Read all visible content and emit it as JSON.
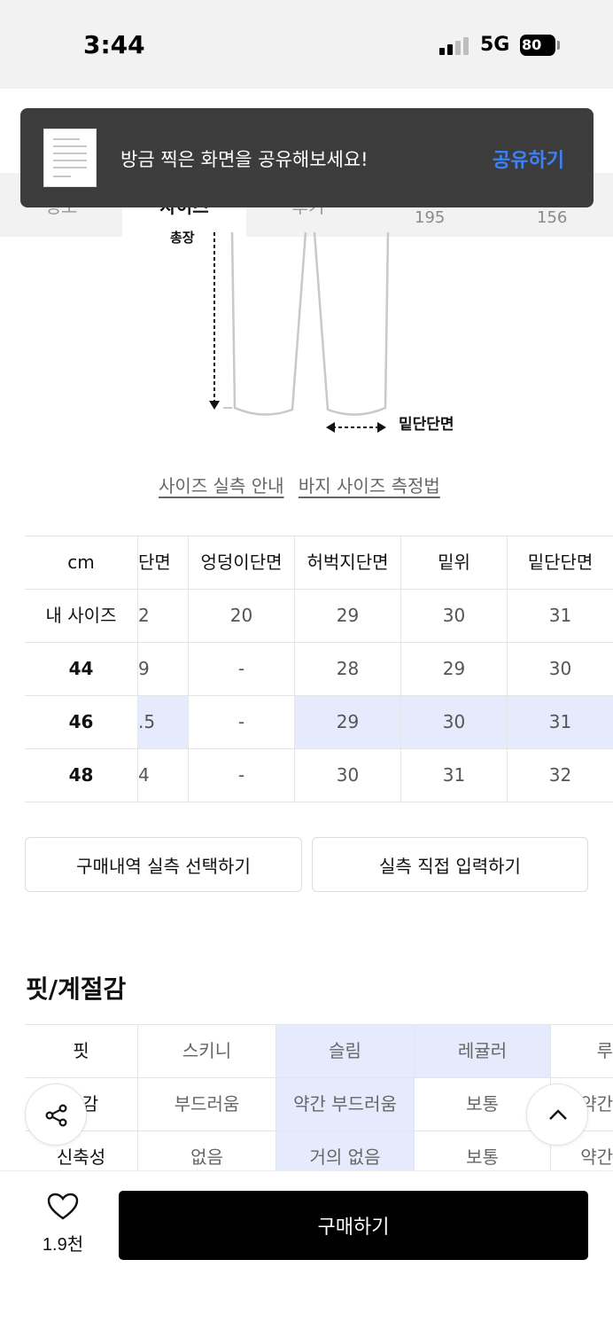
{
  "status_bar": {
    "time": "3:44",
    "network": "5G",
    "battery": "80"
  },
  "tabs": {
    "items": [
      {
        "label": "정보"
      },
      {
        "label": "사이즈"
      },
      {
        "label": "후기"
      }
    ],
    "active_index": 1,
    "overflow_values": [
      "195",
      "156"
    ]
  },
  "toast": {
    "message": "방금 찍은 화면을 공유해보세요!",
    "action": "공유하기"
  },
  "diagram": {
    "label_length": "총장",
    "label_bottom": "밑단단면"
  },
  "links": {
    "size_guide": "사이즈 실측 안내",
    "measure_guide": "바지 사이즈 측정법"
  },
  "size_table": {
    "corner": "cm",
    "columns": [
      "단면",
      "엉덩이단면",
      "허벅지단면",
      "밑위",
      "밑단단면"
    ],
    "rows": [
      {
        "name": "내 사이즈",
        "values": [
          "2",
          "20",
          "29",
          "30",
          "31"
        ]
      },
      {
        "name": "44",
        "values": [
          "9",
          "-",
          "28",
          "29",
          "30"
        ]
      },
      {
        "name": "46",
        "values": [
          ".5",
          "-",
          "29",
          "30",
          "31"
        ]
      },
      {
        "name": "48",
        "values": [
          "4",
          "-",
          "30",
          "31",
          "32"
        ]
      }
    ],
    "highlight_row": "46",
    "highlight_color": "#e5ebfc"
  },
  "buttons": {
    "purchase_history": "구매내역 실측 선택하기",
    "direct_input": "실측 직접 입력하기"
  },
  "fit_section": {
    "title": "핏/계절감",
    "rows": [
      {
        "name": "핏",
        "options": [
          "스키니",
          "슬림",
          "레귤러",
          "루"
        ],
        "selected": [
          1,
          2
        ]
      },
      {
        "name": "감",
        "options": [
          "부드러움",
          "약간 부드러움",
          "보통",
          "약간"
        ],
        "selected": [
          1
        ]
      },
      {
        "name": "신축성",
        "options": [
          "없음",
          "거의 없음",
          "보통",
          "약간"
        ],
        "selected": [
          1
        ]
      }
    ]
  },
  "bottom_bar": {
    "like_count": "1.9천",
    "buy_label": "구매하기"
  },
  "icons": {
    "share": "share-icon",
    "scroll_top": "chevron-up-icon",
    "heart": "heart-icon"
  }
}
